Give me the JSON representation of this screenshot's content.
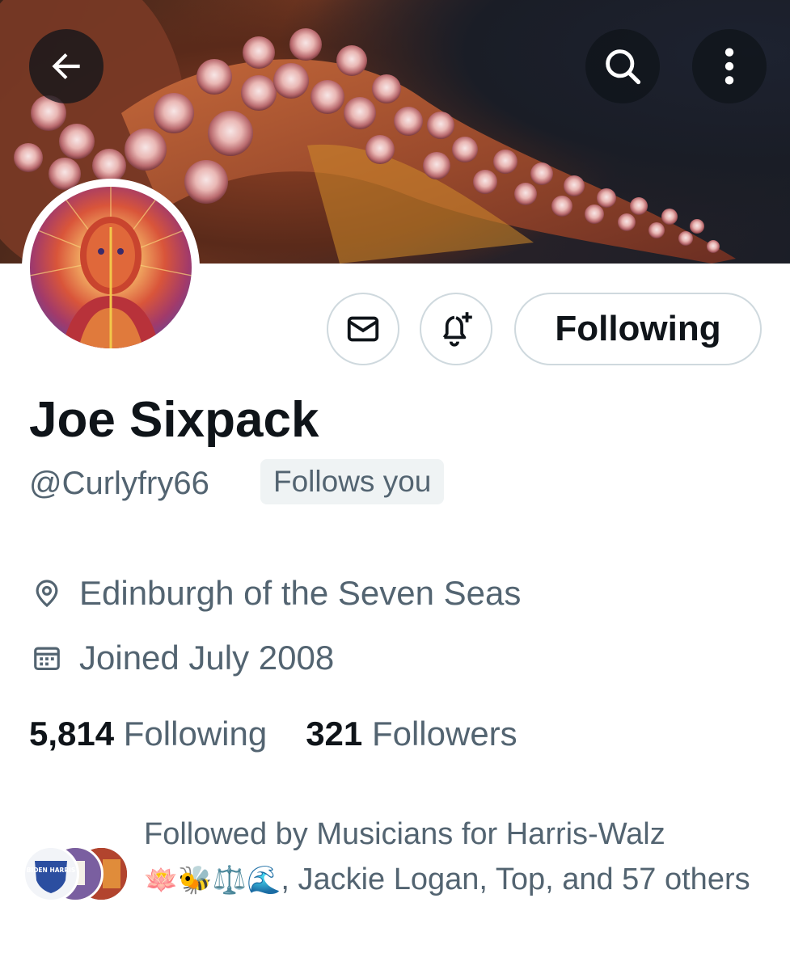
{
  "header": {
    "back_icon": "arrow-left-icon",
    "search_icon": "search-icon",
    "more_icon": "more-vertical-icon"
  },
  "profile": {
    "name": "Joe Sixpack",
    "handle": "@Curlyfry66",
    "follows_you": "Follows you",
    "location": "Edinburgh of the Seven Seas",
    "joined": "Joined July 2008",
    "following_count": "5,814",
    "following_label": "Following",
    "followers_count": "321",
    "followers_label": "Followers"
  },
  "actions": {
    "message_icon": "mail-icon",
    "notify_icon": "bell-plus-icon",
    "follow_button": "Following"
  },
  "followed_by": {
    "prefix": "Followed by Musicians for Harris-Walz",
    "emojis": "🪷🐝⚖️🌊",
    "suffix": ", Jackie Logan, Top, and 57 others",
    "avatar_1_text": "BIDEN HARRIS"
  },
  "colors": {
    "text_primary": "#0f1419",
    "text_secondary": "#536471",
    "border": "#cfd9de",
    "chip_bg": "#eff3f4"
  }
}
